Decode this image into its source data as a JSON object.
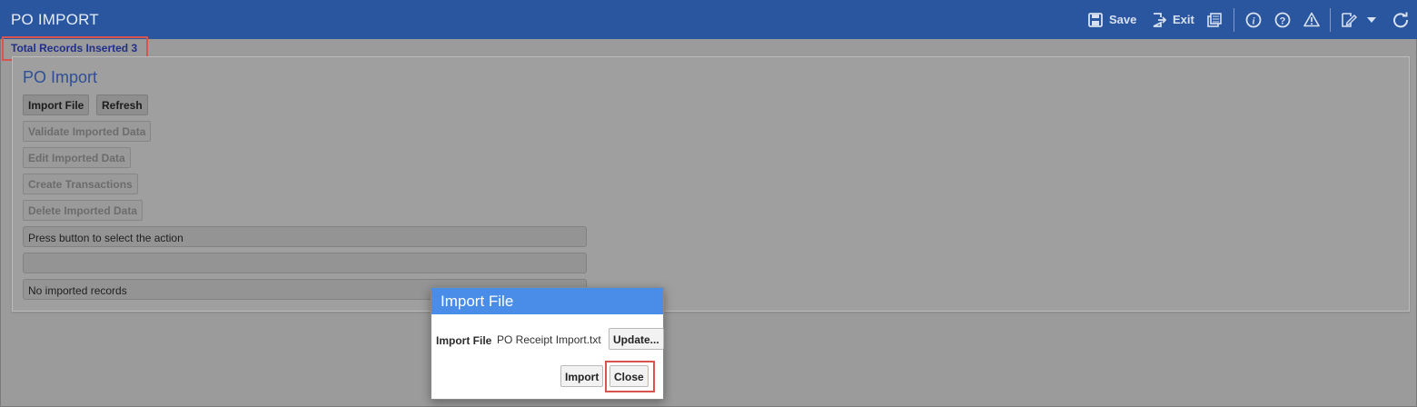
{
  "app": {
    "title": "PO IMPORT"
  },
  "toolbar": {
    "save_label": "Save",
    "exit_label": "Exit",
    "icons": [
      "save-icon",
      "exit-icon",
      "report-icon",
      "info-icon",
      "help-icon",
      "warning-icon",
      "edit-note-icon",
      "chevron-down-icon",
      "refresh-icon"
    ]
  },
  "status": {
    "records_inserted": "Total Records Inserted 3"
  },
  "panel": {
    "title": "PO Import",
    "buttons": {
      "import_file": "Import File",
      "refresh": "Refresh",
      "validate": "Validate Imported Data",
      "edit": "Edit Imported Data",
      "create": "Create Transactions",
      "delete": "Delete Imported Data"
    },
    "fields": {
      "action_message": "Press button to select the action",
      "progress": "",
      "records_message": "No imported records"
    }
  },
  "dialog": {
    "title": "Import File",
    "file_label": "Import File",
    "file_name": "PO Receipt Import.txt",
    "update_label": "Update...",
    "import_label": "Import",
    "close_label": "Close"
  },
  "colors": {
    "header_bg": "#2a56a0",
    "overlay_bg": "#9b9b9b",
    "dialog_header": "#4a8de8",
    "highlight": "#d9534f"
  }
}
